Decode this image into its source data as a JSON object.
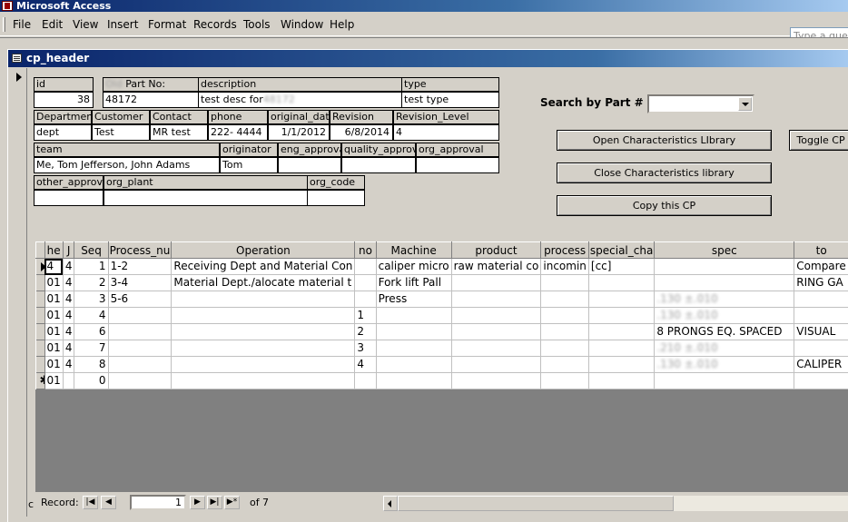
{
  "app": {
    "title": "Microsoft Access",
    "ask_placeholder": "Type a question for help"
  },
  "menu": [
    "File",
    "Edit",
    "View",
    "Insert",
    "Format",
    "Records",
    "Tools",
    "Window",
    "Help"
  ],
  "form": {
    "title": "cp_header",
    "fields": {
      "id": {
        "label": "id",
        "value": "38"
      },
      "part_no": {
        "label_prefix": "Old",
        "label": "Part No:",
        "value": "48172"
      },
      "description": {
        "label": "description",
        "value": "test desc  for",
        "value_blurred": "48172"
      },
      "type": {
        "label": "type",
        "value": "test type"
      },
      "department": {
        "label": "Department",
        "value": "dept"
      },
      "customer": {
        "label": "Customer",
        "value": "Test"
      },
      "contact": {
        "label": "Contact",
        "value": "MR test"
      },
      "phone": {
        "label": "phone",
        "value": "222- 4444"
      },
      "original_date": {
        "label": "original_date",
        "value": "1/1/2012"
      },
      "revision": {
        "label": "Revision",
        "value": "6/8/2014"
      },
      "revision_level": {
        "label": "Revision_Level",
        "value": "4"
      },
      "team": {
        "label": "team",
        "value": "Me, Tom Jefferson, John Adams"
      },
      "originator": {
        "label": "originator",
        "value": "Tom"
      },
      "eng_approval": {
        "label": "eng_approval",
        "value": ""
      },
      "quality_approval": {
        "label": "quality_approval",
        "value": ""
      },
      "org_approval": {
        "label": "org_approval",
        "value": ""
      },
      "other_approval": {
        "label": "other_approval",
        "value": ""
      },
      "org_plant": {
        "label": "org_plant",
        "value": ""
      },
      "org_code": {
        "label": "org_code",
        "value": ""
      }
    },
    "search": {
      "label": "Search by Part #",
      "value": ""
    },
    "buttons": {
      "open_lib": "Open  Characteristics LIbrary",
      "close_lib": "Close Characteristics library",
      "copy_cp": "Copy this CP",
      "toggle_cp": "Toggle CP"
    }
  },
  "grid": {
    "columns": [
      "he",
      "J",
      "Seq",
      "Process_nu",
      "Operation",
      "no",
      "Machine",
      "product",
      "process",
      "special_cha",
      "spec",
      "to"
    ],
    "rows": [
      {
        "he": "4",
        "j": "4",
        "seq": "1",
        "process_nu": "1-2",
        "operation": "Receiving Dept and Material Con",
        "no": "",
        "machine": "caliper micro",
        "product": "raw material co",
        "process": "incomin",
        "special": "[cc]",
        "spec": "",
        "spec_blur": "",
        "to": "Compare"
      },
      {
        "he": "01",
        "j": "4",
        "seq": "2",
        "process_nu": "3-4",
        "operation": "Material Dept./alocate material  t",
        "no": "",
        "machine": "Fork lift Pall",
        "product": "",
        "process": "",
        "special": "",
        "spec": "",
        "spec_blur": "",
        "to": "RING GA"
      },
      {
        "he": "01",
        "j": "4",
        "seq": "3",
        "process_nu": "5-6",
        "operation": "",
        "no": "",
        "machine": "Press",
        "product": "",
        "process": "",
        "special": "",
        "spec": "",
        "spec_blur": ".130 ±.010",
        "to": ""
      },
      {
        "he": "01",
        "j": "4",
        "seq": "4",
        "process_nu": "",
        "operation": "",
        "no": "1",
        "machine": "",
        "product": "",
        "process": "",
        "special": "",
        "spec": "",
        "spec_blur": ".130 ±.010",
        "to": ""
      },
      {
        "he": "01",
        "j": "4",
        "seq": "6",
        "process_nu": "",
        "operation": "",
        "no": "2",
        "machine": "",
        "product": "",
        "process": "",
        "special": "",
        "spec": "8 PRONGS EQ. SPACED",
        "spec_blur": "",
        "to": "VISUAL"
      },
      {
        "he": "01",
        "j": "4",
        "seq": "7",
        "process_nu": "",
        "operation": "",
        "no": "3",
        "machine": "",
        "product": "",
        "process": "",
        "special": "",
        "spec": "",
        "spec_blur": ".210 ±.010",
        "to": ""
      },
      {
        "he": "01",
        "j": "4",
        "seq": "8",
        "process_nu": "",
        "operation": "",
        "no": "4",
        "machine": "",
        "product": "",
        "process": "",
        "special": "",
        "spec": "",
        "spec_blur": ".130 ±.010",
        "to": "CALIPER"
      }
    ],
    "new_row": {
      "he": "01",
      "seq": "0"
    }
  },
  "nav": {
    "label": "Record:",
    "current": "1",
    "of": "of",
    "total": "7"
  },
  "misc": {
    "c_mark": "c"
  }
}
